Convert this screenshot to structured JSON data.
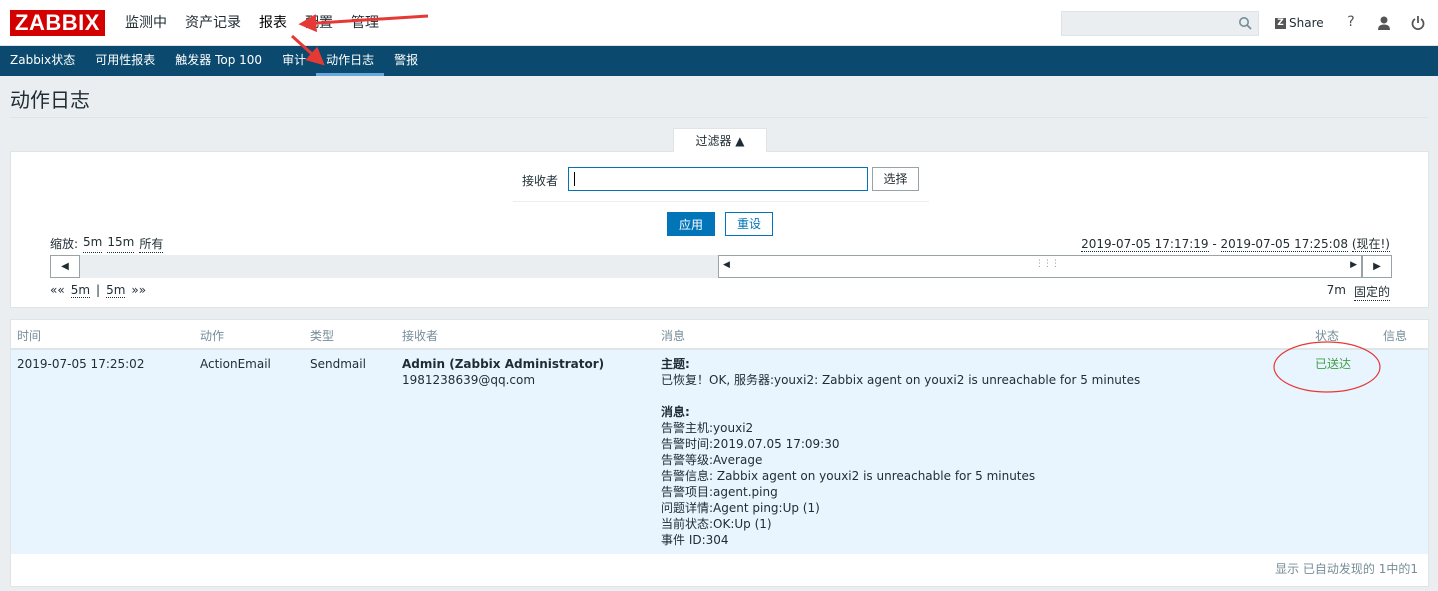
{
  "header": {
    "logo": "ZABBIX",
    "menu": [
      "监测中",
      "资产记录",
      "报表",
      "配置",
      "管理"
    ],
    "selected_menu": "报表",
    "share": "Share",
    "help": "?",
    "icons": [
      "search-icon",
      "share-icon",
      "help-icon",
      "user-icon",
      "power-icon"
    ]
  },
  "submenu": [
    "Zabbix状态",
    "可用性报表",
    "触发器 Top 100",
    "审计",
    "动作日志",
    "警报"
  ],
  "page_title": "动作日志",
  "filter": {
    "tab_label": "过滤器 ▲",
    "recipient_label": "接收者",
    "recipient_value": "",
    "select_button": "选择",
    "apply_button": "应用",
    "reset_button": "重设",
    "zoom_label": "缩放:",
    "zoom_options": [
      "5m",
      "15m",
      "所有"
    ],
    "range_from": "2019-07-05 17:17:19",
    "range_sep": " - ",
    "range_to": "2019-07-05 17:25:08",
    "range_now": "(现在!)",
    "nav_back": "««",
    "nav_back_5m": "5m",
    "nav_sep": "|",
    "nav_fwd_5m": "5m",
    "nav_fwd": "»»",
    "period": "7m",
    "fixed": "固定的"
  },
  "table": {
    "columns": [
      "时间",
      "动作",
      "类型",
      "接收者",
      "消息",
      "状态",
      "信息"
    ],
    "rows": [
      {
        "time": "2019-07-05 17:25:02",
        "action": "ActionEmail",
        "type": "Sendmail",
        "recipient_name": "Admin (Zabbix Administrator)",
        "recipient_email": "1981238639@qq.com",
        "subject_label": "主题:",
        "subject": "已恢复！OK, 服务器:youxi2: Zabbix agent on youxi2 is unreachable for 5 minutes",
        "message_label": "消息:",
        "message_lines": [
          "告警主机:youxi2",
          "告警时间:2019.07.05 17:09:30",
          "告警等级:Average",
          "告警信息: Zabbix agent on youxi2 is unreachable for 5 minutes",
          "告警项目:agent.ping",
          "问题详情:Agent ping:Up (1)",
          "当前状态:OK:Up (1)",
          "事件 ID:304"
        ],
        "status": "已送达"
      }
    ],
    "footer": "显示 已自动发现的 1中的1"
  },
  "colors": {
    "logo_bg": "#d40000",
    "submenu_bg": "#0b4a6e",
    "primary": "#0275b8",
    "status_ok": "#429e47",
    "annotation": "#e53935"
  }
}
